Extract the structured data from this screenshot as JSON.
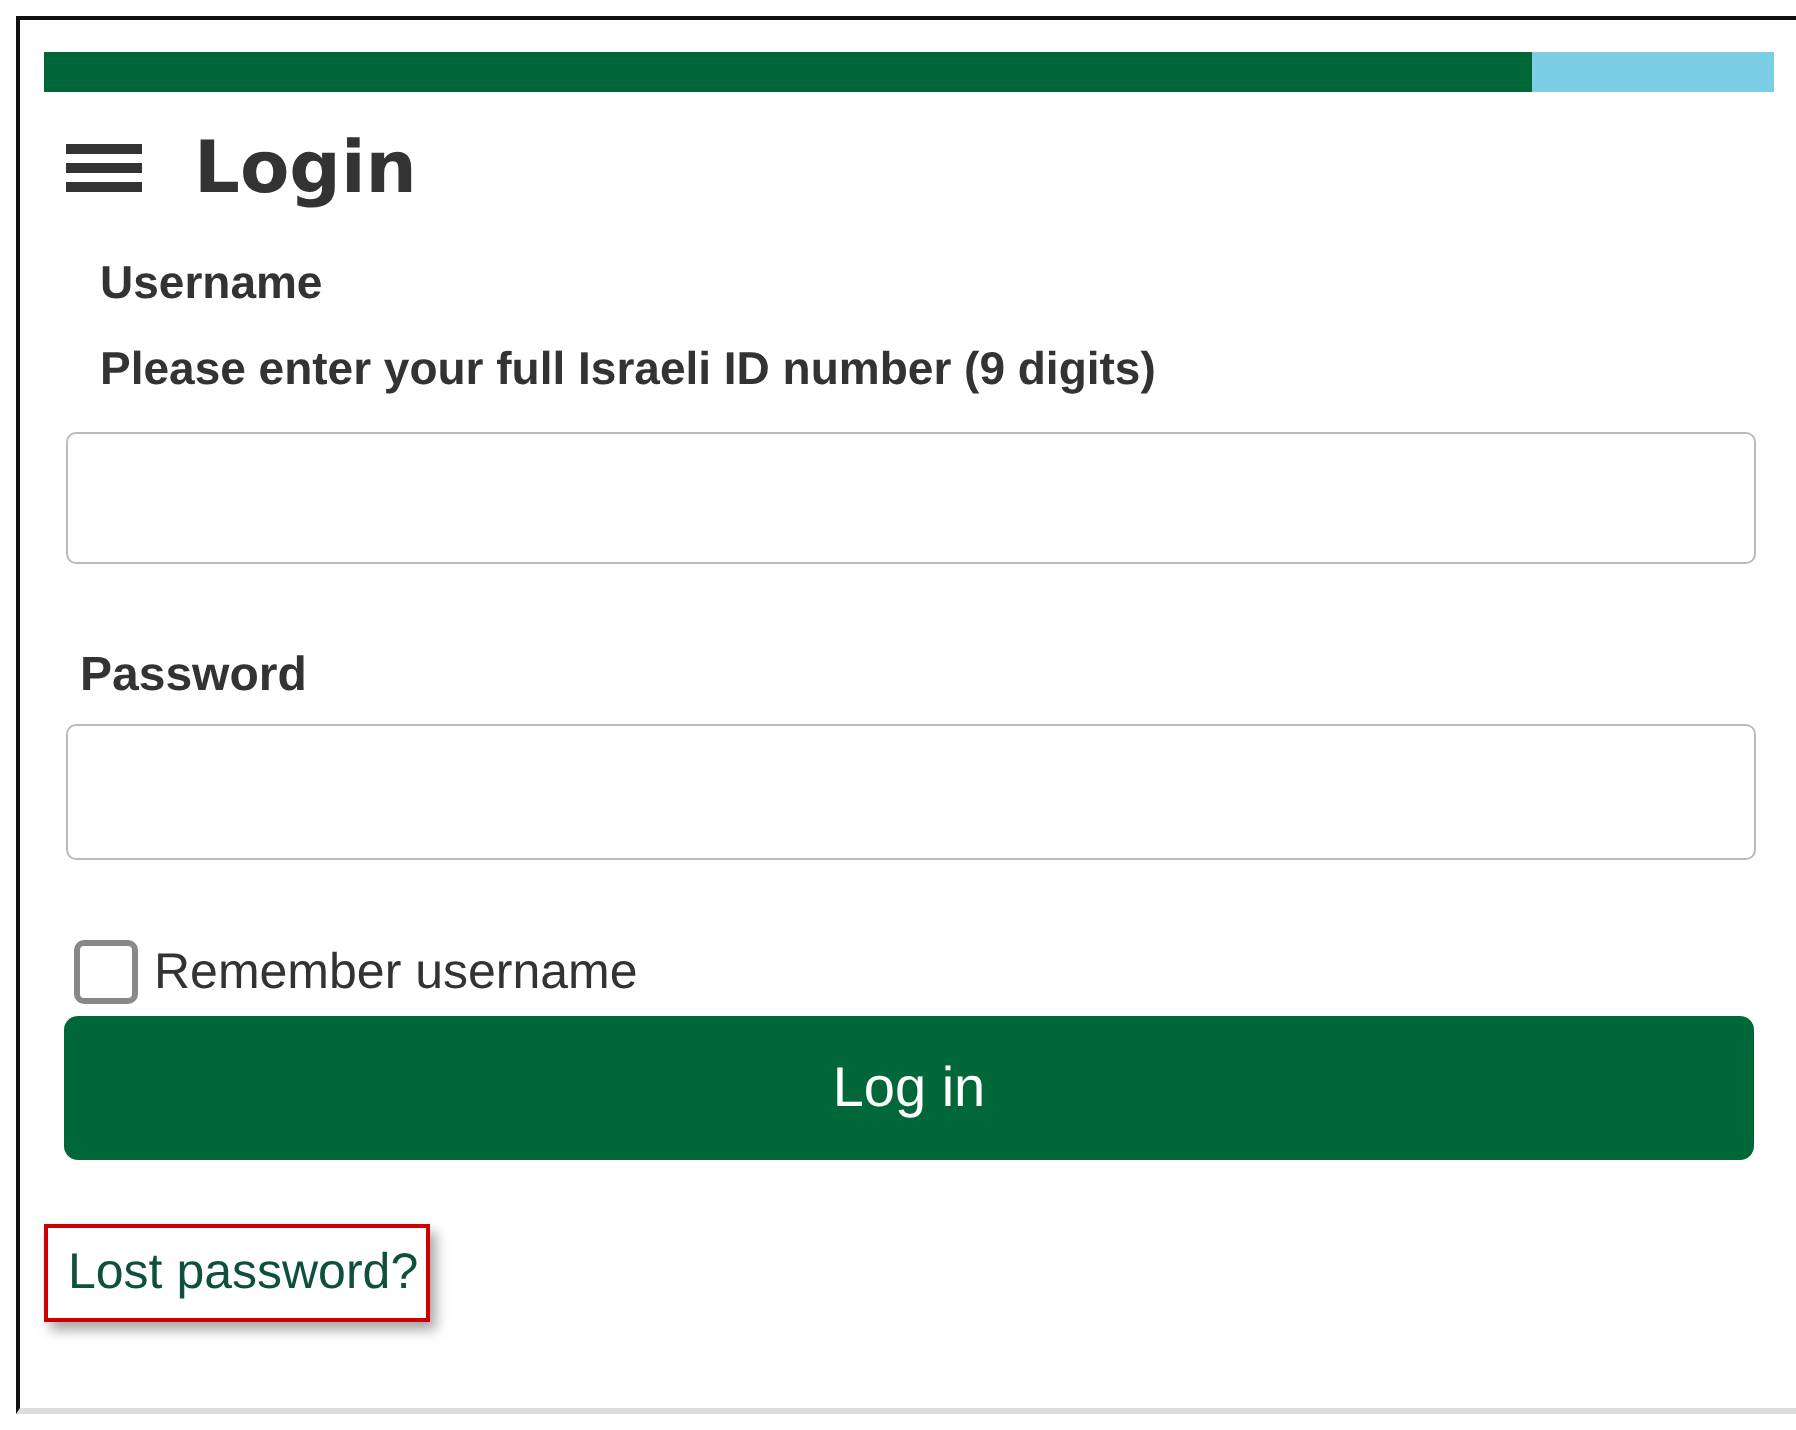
{
  "progress": {
    "level": 0.86
  },
  "header": {
    "title": "Login"
  },
  "username": {
    "label": "Username",
    "hint": "Please enter your full Israeli ID number (9 digits)"
  },
  "password": {
    "label": "Password"
  },
  "remember": {
    "label": "Remember username",
    "checked": false
  },
  "login_button": "Log in",
  "lost_password_link": "Lost password?"
}
